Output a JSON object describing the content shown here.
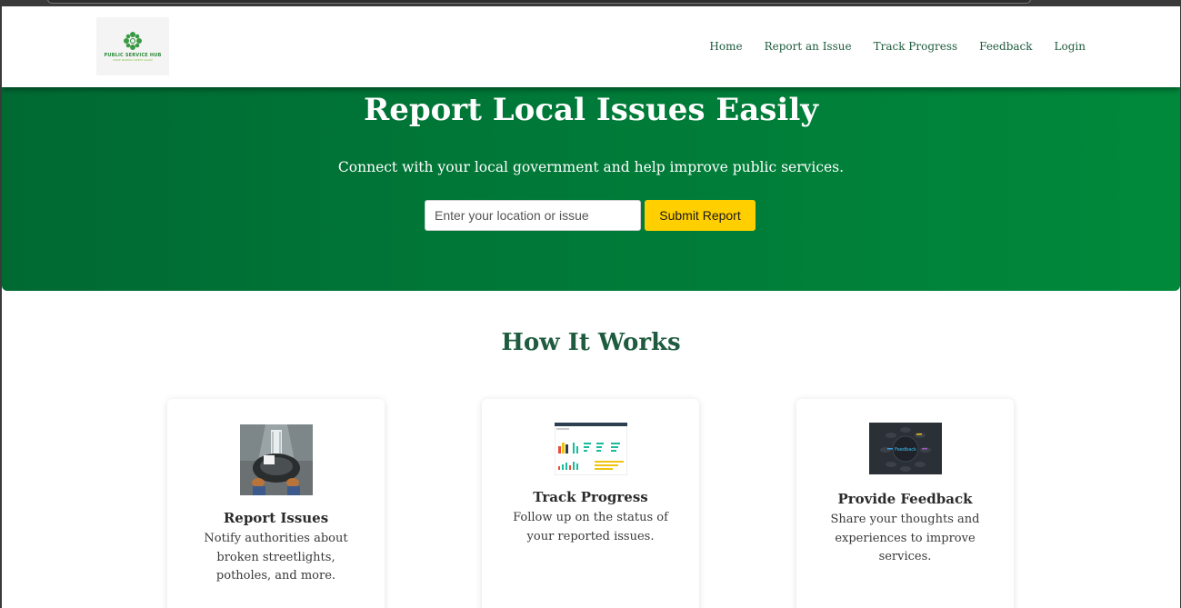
{
  "logo": {
    "name": "PUBLIC SERVICE HUB",
    "tagline": "MAKE NIGERIA GREAT AGAIN"
  },
  "nav": {
    "items": [
      "Home",
      "Report an Issue",
      "Track Progress",
      "Feedback",
      "Login"
    ]
  },
  "hero": {
    "title": "Report Local Issues Easily",
    "subtitle": "Connect with your local government and help improve public services.",
    "input_placeholder": "Enter your location or issue",
    "submit_label": "Submit Report"
  },
  "how_it_works": {
    "title": "How It Works",
    "cards": [
      {
        "title": "Report Issues",
        "description": "Notify authorities about broken streetlights, potholes, and more.",
        "image": "pothole-photo"
      },
      {
        "title": "Track Progress",
        "description": "Follow up on the status of your reported issues.",
        "image": "dashboard-screenshot"
      },
      {
        "title": "Provide Feedback",
        "description": "Share your thoughts and experiences to improve services.",
        "image": "feedback-illustration",
        "image_text": "Feedback"
      }
    ]
  },
  "colors": {
    "brand_green": "#007a38",
    "heading_green": "#1f5c3f",
    "button_yellow": "#ffcf00"
  }
}
